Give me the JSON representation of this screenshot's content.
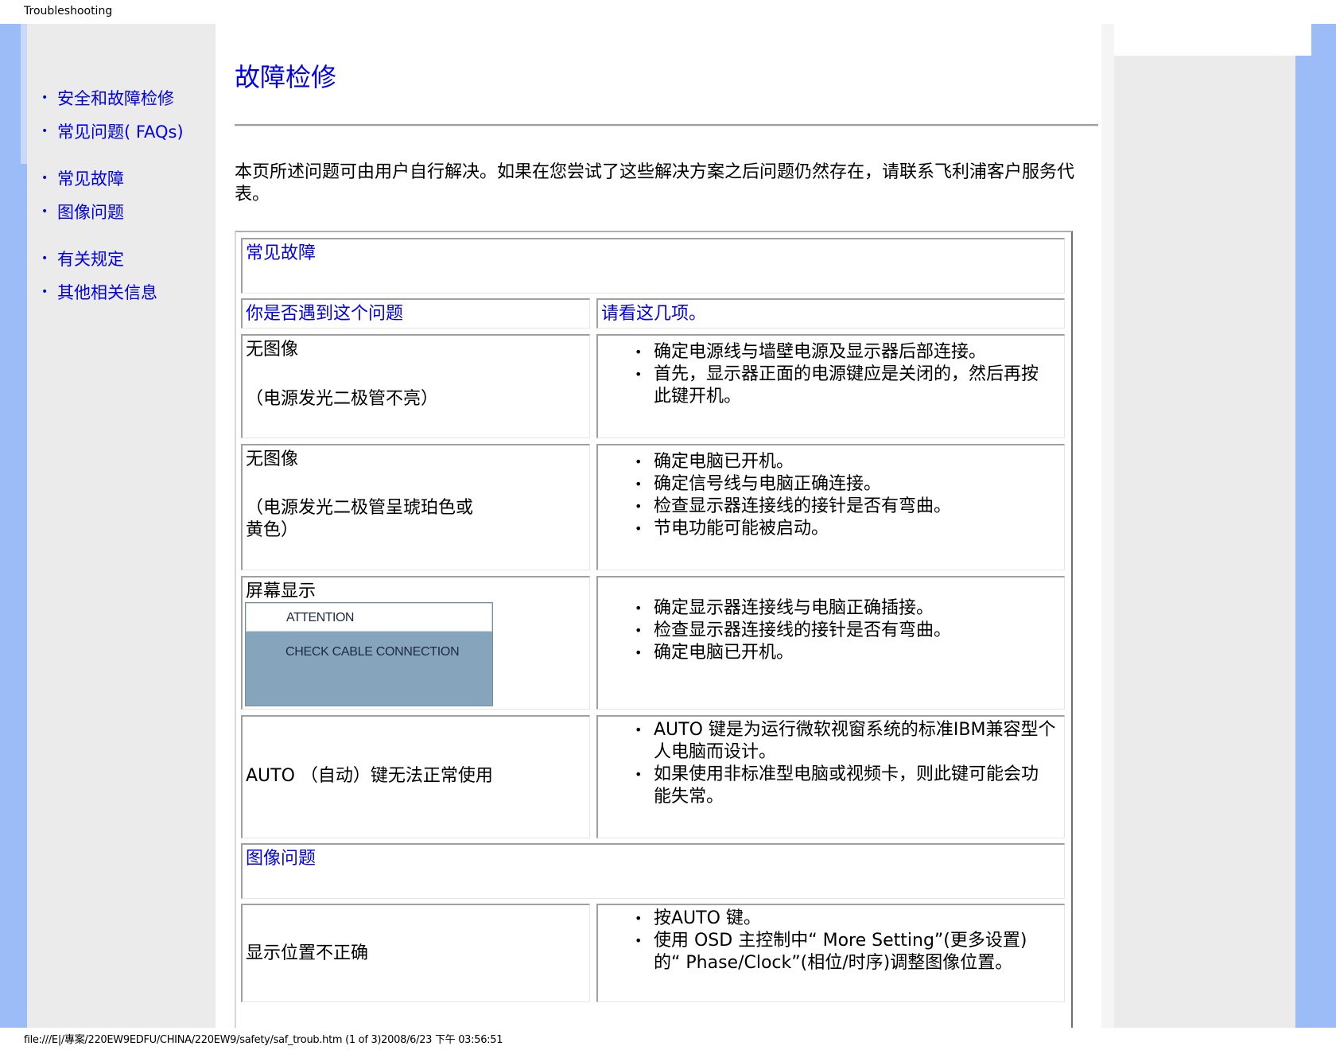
{
  "header": {
    "title": "Troubleshooting"
  },
  "footer": {
    "path": "file:///E|/專案/220EW9EDFU/CHINA/220EW9/safety/saf_troub.htm (1 of 3)2008/6/23 下午 03:56:51"
  },
  "sidebar": {
    "items": [
      {
        "label": "安全和故障检修"
      },
      {
        "label": "常见问题( FAQs)"
      },
      {
        "label": "常见故障"
      },
      {
        "label": "图像问题"
      },
      {
        "label": "有关规定"
      },
      {
        "label": "其他相关信息"
      }
    ]
  },
  "main": {
    "title": "故障检修",
    "intro": "本页所述问题可由用户自行解决。如果在您尝试了这些解决方案之后问题仍然存在，请联系飞利浦客户服务代表。",
    "section1": {
      "heading": "常见故障",
      "col1_header": "你是否遇到这个问题",
      "col2_header": "请看这几项。",
      "rows": [
        {
          "problem_line1": "无图像",
          "problem_line2": "（电源发光二极管不亮）",
          "solutions": [
            "确定电源线与墙壁电源及显示器后部连接。",
            "首先，显示器正面的电源键应是关闭的，然后再按",
            "此键开机。"
          ]
        },
        {
          "problem_line1": "无图像",
          "problem_line2": "（电源发光二极管呈琥珀色或",
          "problem_line3": "黄色）",
          "solutions": [
            "确定电脑已开机。",
            "确定信号线与电脑正确连接。",
            "检查显示器连接线的接针是否有弯曲。",
            "节电功能可能被启动。"
          ]
        },
        {
          "problem_line1": "屏幕显示",
          "osd_title": "ATTENTION",
          "osd_message": "CHECK CABLE CONNECTION",
          "solutions": [
            "确定显示器连接线与电脑正确插接。",
            "检查显示器连接线的接针是否有弯曲。",
            "确定电脑已开机。"
          ]
        },
        {
          "problem_line1": "AUTO （自动）键无法正常使用",
          "solutions": [
            "AUTO 键是为运行微软视窗系统的标准IBM兼容型个",
            "人电脑而设计。",
            "如果使用非标准型电脑或视频卡，则此键可能会功",
            "能失常。"
          ]
        }
      ]
    },
    "section2": {
      "heading": "图像问题",
      "rows": [
        {
          "problem_line1": "显示位置不正确",
          "solutions": [
            "按AUTO 键。",
            "使用 OSD 主控制中“ More Setting”(更多设置)",
            "的“ Phase/Clock”(相位/时序)调整图像位置。"
          ]
        }
      ]
    }
  }
}
